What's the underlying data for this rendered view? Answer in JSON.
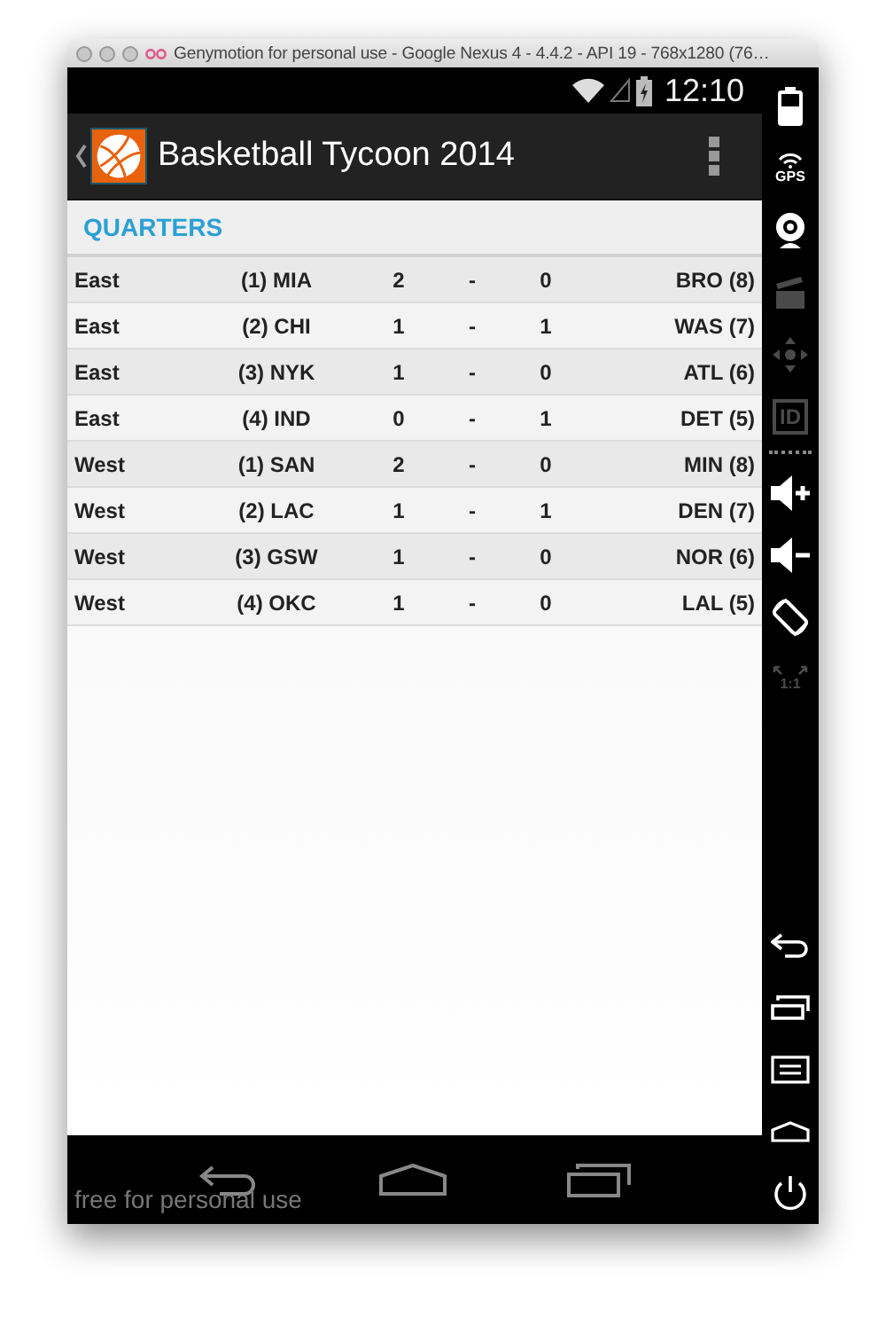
{
  "emulator": {
    "title": "Genymotion for personal use - Google Nexus 4 - 4.4.2 - API 19 - 768x1280 (76…",
    "sidebar": [
      {
        "kind": "battery",
        "disabled": false
      },
      {
        "kind": "gps",
        "label": "GPS",
        "disabled": false
      },
      {
        "kind": "webcam",
        "disabled": false
      },
      {
        "kind": "clapper",
        "disabled": true
      },
      {
        "kind": "dpad",
        "disabled": true
      },
      {
        "kind": "id",
        "label": "ID",
        "disabled": true
      },
      {
        "kind": "grip"
      },
      {
        "kind": "volume-up",
        "disabled": false
      },
      {
        "kind": "volume-down",
        "disabled": false
      },
      {
        "kind": "rotate",
        "disabled": false
      },
      {
        "kind": "ratio",
        "label": "1:1",
        "disabled": true
      },
      {
        "kind": "spacer"
      },
      {
        "kind": "back",
        "disabled": false
      },
      {
        "kind": "recents",
        "disabled": false
      },
      {
        "kind": "menu",
        "disabled": false
      },
      {
        "kind": "home",
        "disabled": false
      },
      {
        "kind": "power",
        "disabled": false
      }
    ]
  },
  "status_bar": {
    "time": "12:10"
  },
  "action_bar": {
    "title": "Basketball Tycoon 2014"
  },
  "section": {
    "title": "QUARTERS"
  },
  "rows": [
    {
      "conference": "East",
      "home": "(1) MIA",
      "home_score": "2",
      "separator": "-",
      "away_score": "0",
      "away": "BRO (8)"
    },
    {
      "conference": "East",
      "home": "(2) CHI",
      "home_score": "1",
      "separator": "-",
      "away_score": "1",
      "away": "WAS (7)"
    },
    {
      "conference": "East",
      "home": "(3) NYK",
      "home_score": "1",
      "separator": "-",
      "away_score": "0",
      "away": "ATL (6)"
    },
    {
      "conference": "East",
      "home": "(4) IND",
      "home_score": "0",
      "separator": "-",
      "away_score": "1",
      "away": "DET (5)"
    },
    {
      "conference": "West",
      "home": "(1) SAN",
      "home_score": "2",
      "separator": "-",
      "away_score": "0",
      "away": "MIN (8)"
    },
    {
      "conference": "West",
      "home": "(2) LAC",
      "home_score": "1",
      "separator": "-",
      "away_score": "1",
      "away": "DEN (7)"
    },
    {
      "conference": "West",
      "home": "(3) GSW",
      "home_score": "1",
      "separator": "-",
      "away_score": "0",
      "away": "NOR (6)"
    },
    {
      "conference": "West",
      "home": "(4) OKC",
      "home_score": "1",
      "separator": "-",
      "away_score": "0",
      "away": "LAL (5)"
    }
  ],
  "nav_bar": {
    "label": "free for personal use"
  }
}
